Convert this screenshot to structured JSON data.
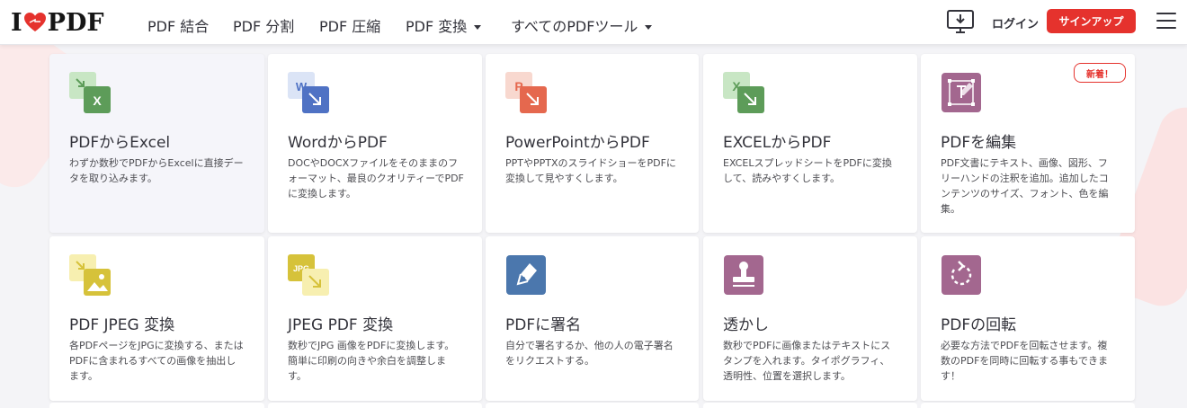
{
  "header": {
    "logo_left": "I",
    "logo_right": "PDF",
    "nav": [
      {
        "label": "PDF 結合",
        "dropdown": false
      },
      {
        "label": "PDF 分割",
        "dropdown": false
      },
      {
        "label": "PDF 圧縮",
        "dropdown": false
      },
      {
        "label": "PDF 変換",
        "dropdown": true
      },
      {
        "label": "すべてのPDFツール",
        "dropdown": true
      }
    ],
    "login": "ログイン",
    "signup": "サインアップ"
  },
  "colors": {
    "brand_red": "#e5322d",
    "excel_green": "#5d9c59",
    "word_blue": "#4f72c4",
    "ppt_orange": "#e5684e",
    "jpg_yellow": "#d6c23a",
    "sign_blue": "#4b77ad",
    "purple": "#a3678f"
  },
  "tools": [
    {
      "title": "PDFからExcel",
      "desc": "わずか数秒でPDFからExcelに直接データを取り込みます。",
      "icon": "pdf-to-excel-icon",
      "badge": ""
    },
    {
      "title": "WordからPDF",
      "desc": "DOCやDOCXファイルをそのままのフォーマット、最良のクオリティーでPDFに変換します。",
      "icon": "word-to-pdf-icon",
      "badge": ""
    },
    {
      "title": "PowerPointからPDF",
      "desc": "PPTやPPTXのスライドショーをPDFに変換して見やすくします。",
      "icon": "powerpoint-to-pdf-icon",
      "badge": ""
    },
    {
      "title": "EXCELからPDF",
      "desc": "EXCELスプレッドシートをPDFに変換して、読みやすくします。",
      "icon": "excel-to-pdf-icon",
      "badge": ""
    },
    {
      "title": "PDFを編集",
      "desc": "PDF文書にテキスト、画像、図形、フリーハンドの注釈を追加。追加したコンテンツのサイズ、フォント、色を編集。",
      "icon": "edit-pdf-icon",
      "badge": "新着！"
    },
    {
      "title": "PDF JPEG 変換",
      "desc": "各PDFページをJPGに変換する、またはPDFに含まれるすべての画像を抽出します。",
      "icon": "pdf-to-jpg-icon",
      "badge": ""
    },
    {
      "title": "JPEG PDF 変換",
      "desc": "数秒でJPG 画像をPDFに変換します。簡単に印刷の向きや余白を調整します。",
      "icon": "jpg-to-pdf-icon",
      "badge": ""
    },
    {
      "title": "PDFに署名",
      "desc": "自分で署名するか、他の人の電子署名をリクエストする。",
      "icon": "sign-pdf-icon",
      "badge": ""
    },
    {
      "title": "透かし",
      "desc": "数秒でPDFに画像またはテキストにスタンプを入れます。タイポグラフィ、透明性、位置を選択します。",
      "icon": "watermark-icon",
      "badge": ""
    },
    {
      "title": "PDFの回転",
      "desc": "必要な方法でPDFを回転させます。複数のPDFを同時に回転する事もできます！",
      "icon": "rotate-pdf-icon",
      "badge": ""
    }
  ]
}
